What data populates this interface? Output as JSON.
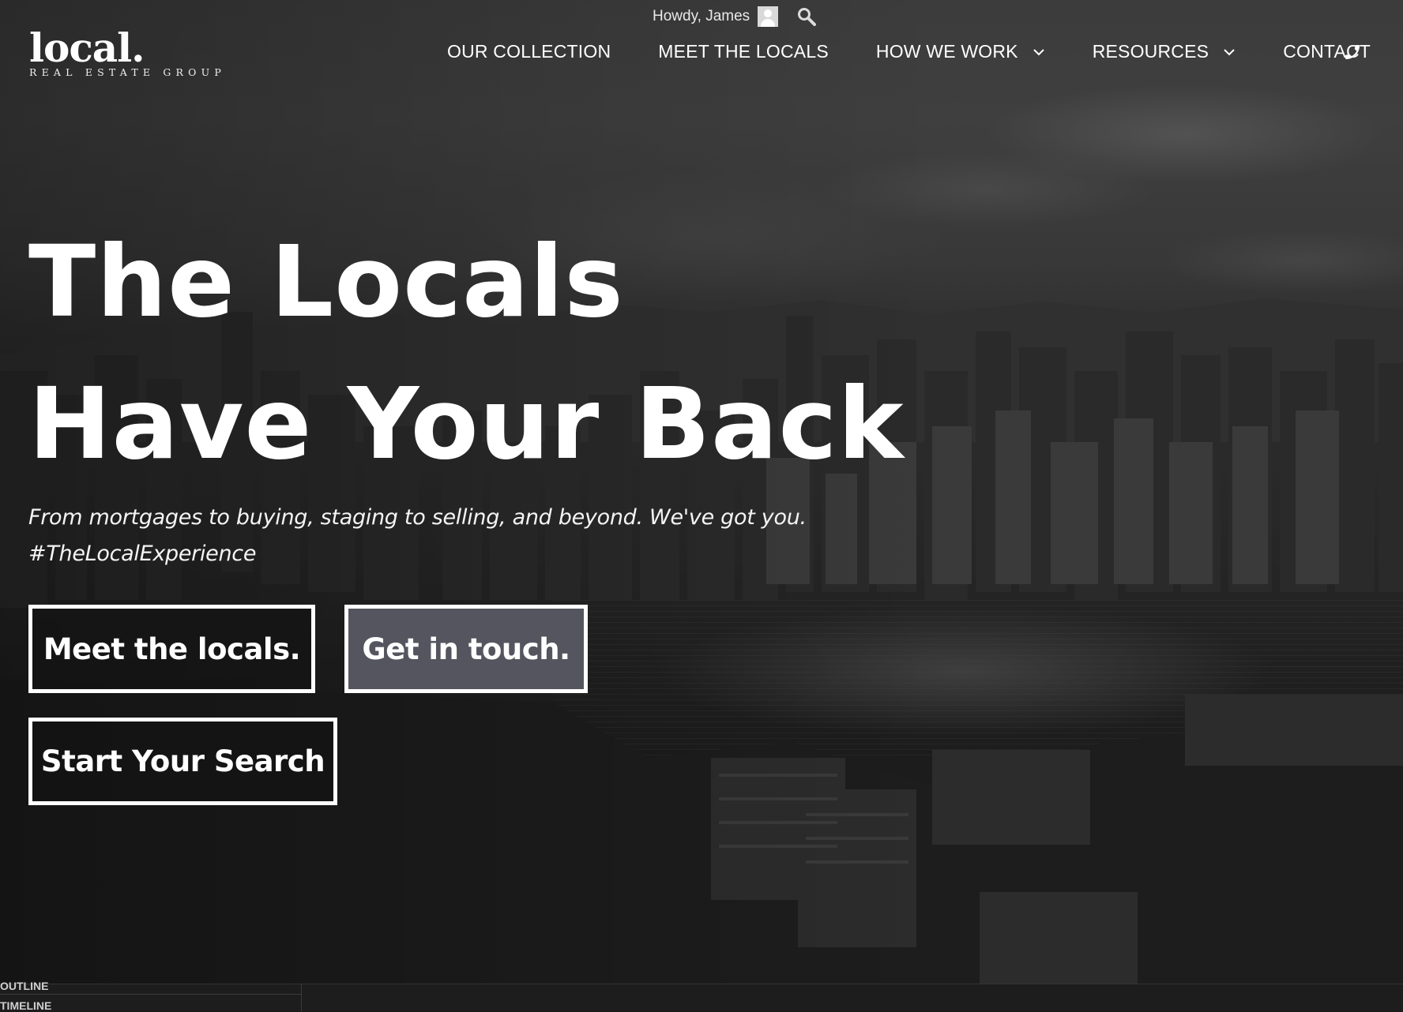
{
  "header": {
    "greeting": "Howdy, James",
    "logo": {
      "word": "local.",
      "tagline": "REAL ESTATE GROUP"
    },
    "nav": [
      {
        "label": "OUR COLLECTION",
        "has_dropdown": false
      },
      {
        "label": "MEET THE LOCALS",
        "has_dropdown": false
      },
      {
        "label": "HOW WE WORK",
        "has_dropdown": true
      },
      {
        "label": "RESOURCES",
        "has_dropdown": true
      },
      {
        "label": "CONTACT",
        "has_dropdown": false
      }
    ],
    "icons": [
      "avatar-icon",
      "search-icon",
      "chevron-down-icon",
      "phone-icon"
    ]
  },
  "hero": {
    "headline_line1": "The Locals",
    "headline_line2": "Have Your Back",
    "subtext_line1": "From mortgages to buying, staging to selling, and beyond. We've got you.",
    "subtext_line2": "#TheLocalExperience",
    "buttons": {
      "meet": "Meet the locals.",
      "touch": "Get in touch.",
      "search": "Start Your Search"
    }
  },
  "devpanel": {
    "outline_label": "OUTLINE",
    "timeline_label": "TIMELINE"
  },
  "colors": {
    "text": "#ffffff",
    "touch_button_bg": "#55555f",
    "panel_bg": "#1d1d1d"
  }
}
